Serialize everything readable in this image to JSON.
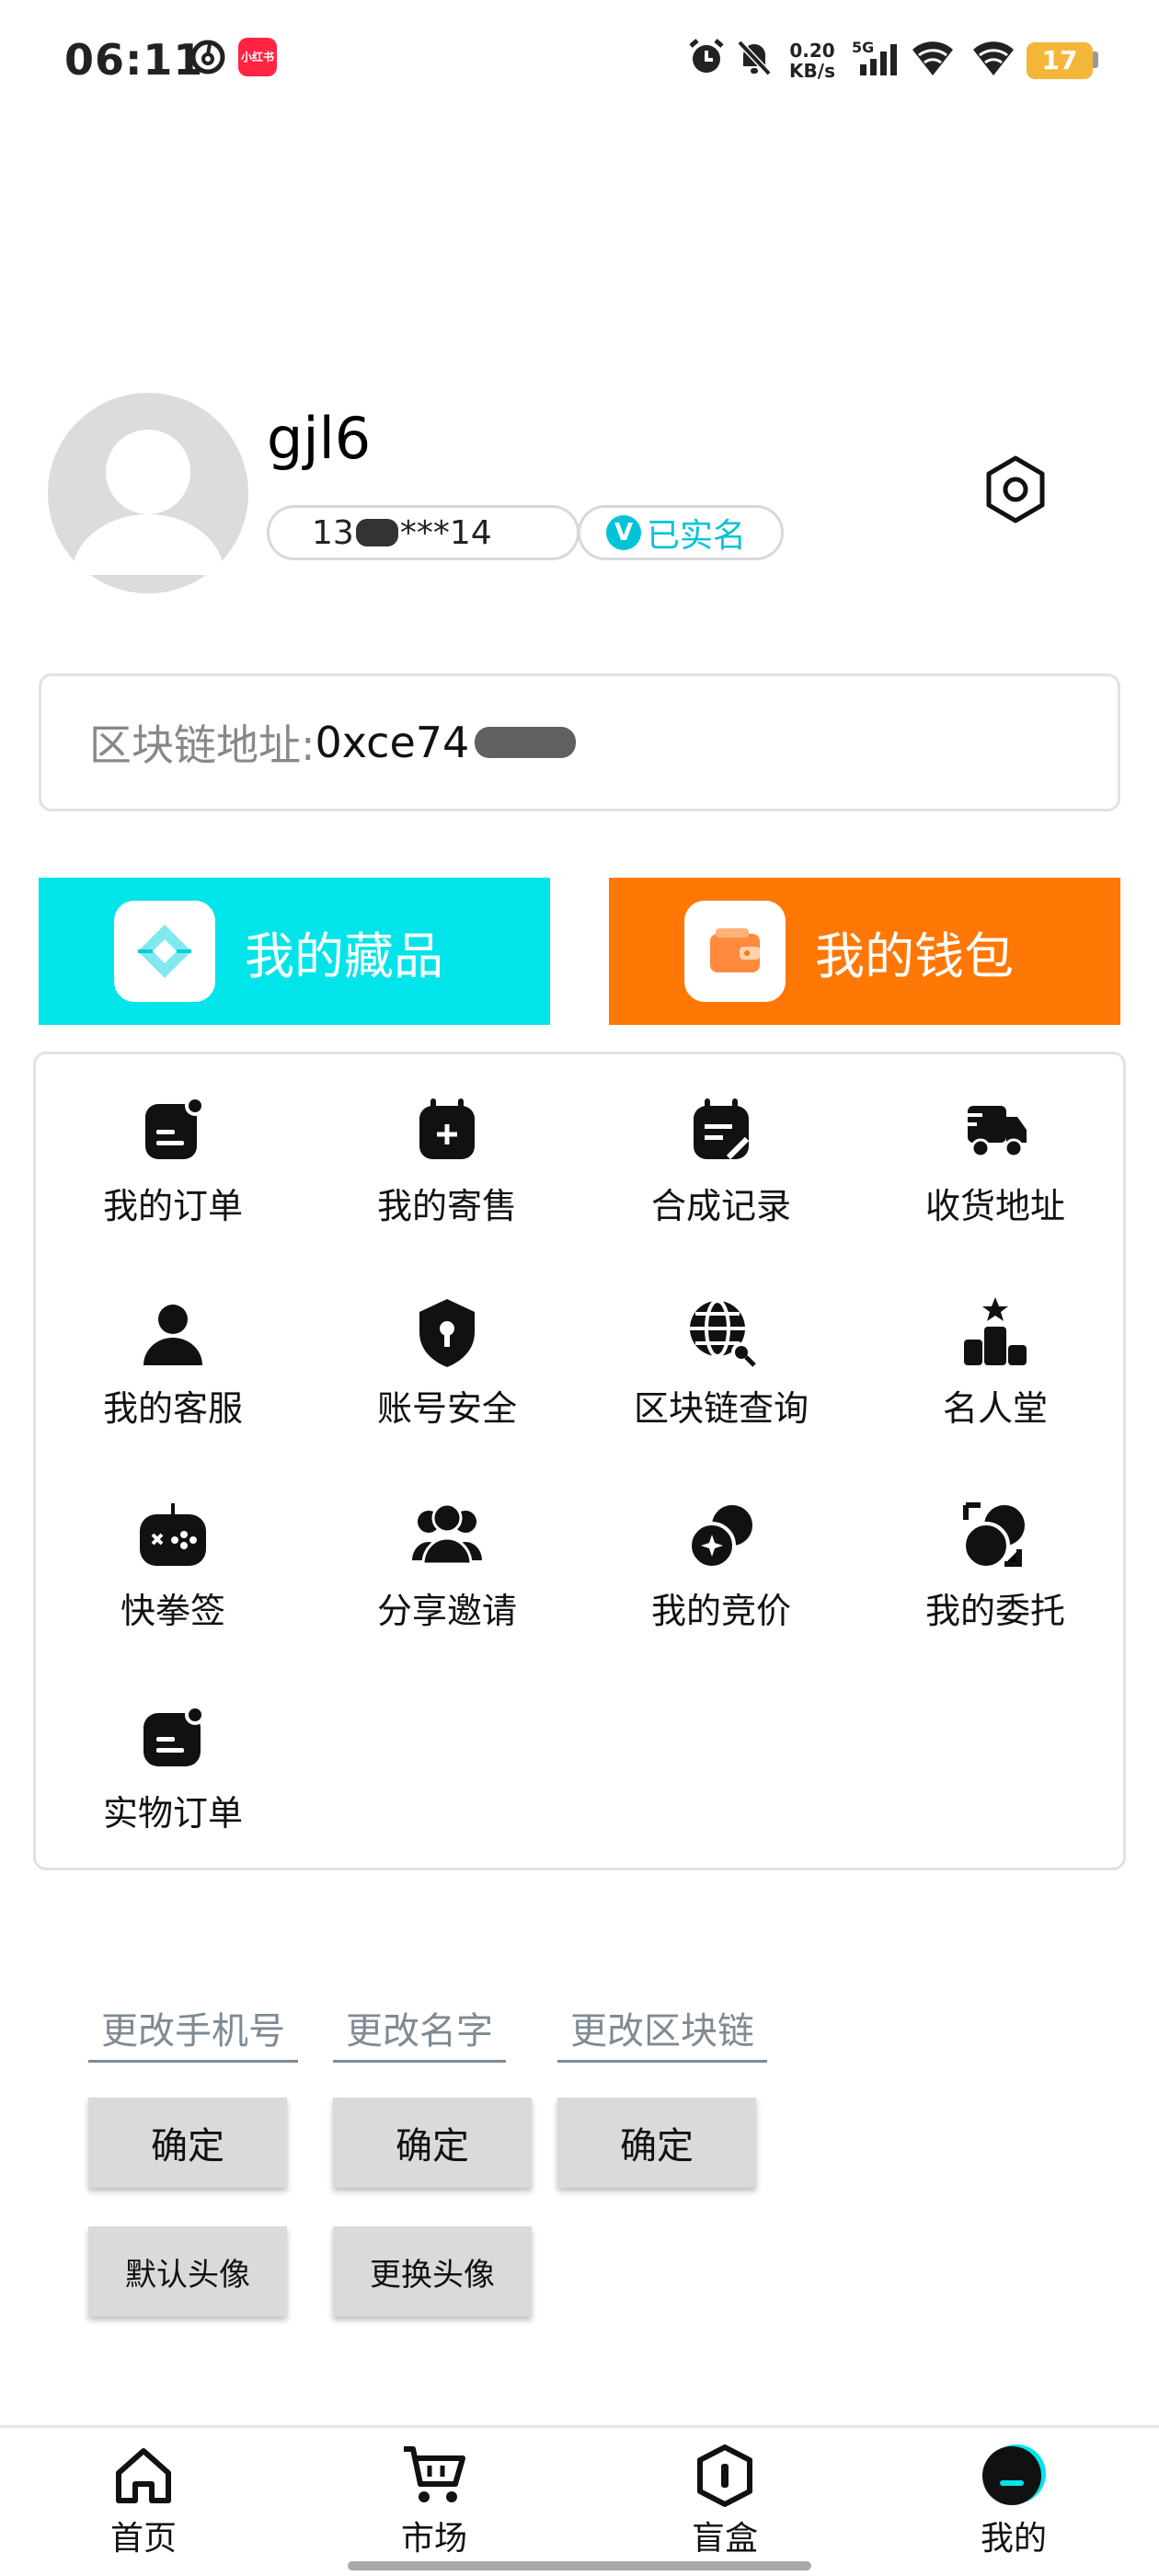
{
  "status_bar": {
    "time": "06:11",
    "net_speed_value": "0.20",
    "net_speed_unit": "KB/s",
    "network_type": "5G",
    "battery": "17",
    "notification_app": "小红书"
  },
  "profile": {
    "username": "gjl6",
    "phone": "13",
    "phone_masked": "***14",
    "verified_label": "已实名",
    "verified_badge": "V"
  },
  "blockchain": {
    "label": "区块链地址:",
    "address": "0xce74"
  },
  "actions": {
    "collection_label": "我的藏品",
    "wallet_label": "我的钱包"
  },
  "menu": {
    "items": [
      {
        "label": "我的订单",
        "icon": "order-icon"
      },
      {
        "label": "我的寄售",
        "icon": "consignment-icon"
      },
      {
        "label": "合成记录",
        "icon": "synthesis-record-icon"
      },
      {
        "label": "收货地址",
        "icon": "truck-icon"
      },
      {
        "label": "我的客服",
        "icon": "customer-service-icon"
      },
      {
        "label": "账号安全",
        "icon": "shield-icon"
      },
      {
        "label": "区块链查询",
        "icon": "globe-search-icon"
      },
      {
        "label": "名人堂",
        "icon": "podium-icon"
      },
      {
        "label": "快拳签",
        "icon": "gamepad-icon"
      },
      {
        "label": "分享邀请",
        "icon": "users-icon"
      },
      {
        "label": "我的竞价",
        "icon": "bid-icon"
      },
      {
        "label": "我的委托",
        "icon": "entrust-icon"
      },
      {
        "label": "实物订单",
        "icon": "physical-order-icon"
      }
    ]
  },
  "change": {
    "phone_link": "更改手机号",
    "name_link": "更改名字",
    "chain_link": "更改区块链",
    "confirm": "确定",
    "default_avatar": "默认头像",
    "change_avatar": "更换头像"
  },
  "bottom_nav": {
    "items": [
      {
        "label": "首页",
        "icon": "home-icon"
      },
      {
        "label": "市场",
        "icon": "cart-icon"
      },
      {
        "label": "盲盒",
        "icon": "blind-box-icon"
      },
      {
        "label": "我的",
        "icon": "profile-icon"
      }
    ]
  },
  "colors": {
    "collection": "#00e4ea",
    "wallet": "#ff7705",
    "verified": "#00c3d8",
    "link": "#7e8a94"
  }
}
